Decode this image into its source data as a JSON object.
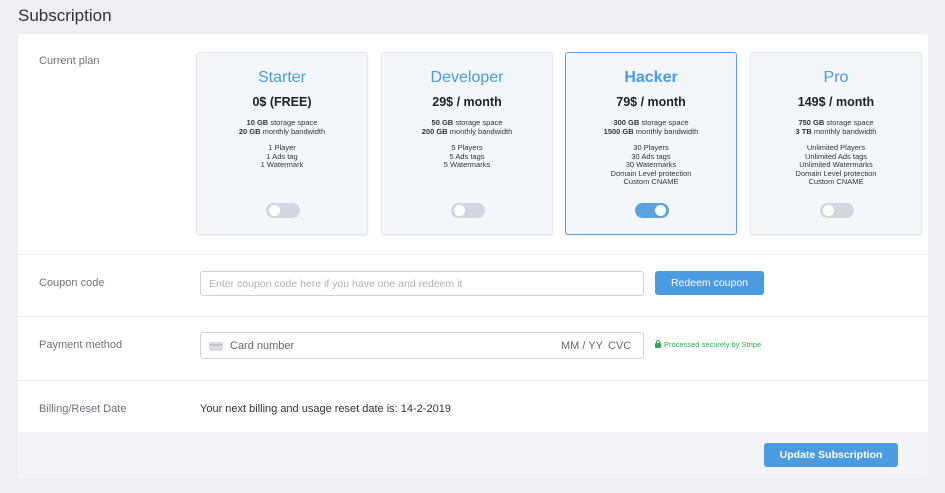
{
  "page": {
    "title": "Subscription"
  },
  "current_plan": {
    "label": "Current plan",
    "plans": [
      {
        "name": "Starter",
        "price": "0$ (FREE)",
        "storage_amount": "10 GB",
        "storage_label": "storage space",
        "bandwidth_amount": "20 GB",
        "bandwidth_label": "monthly bandwidth",
        "features": [
          "1 Player",
          "1 Ads tag",
          "1 Watermark"
        ],
        "selected": false
      },
      {
        "name": "Developer",
        "price": "29$ / month",
        "storage_amount": "50 GB",
        "storage_label": "storage space",
        "bandwidth_amount": "200 GB",
        "bandwidth_label": "monthly bandwidth",
        "features": [
          "5 Players",
          "5 Ads tags",
          "5 Watermarks"
        ],
        "selected": false
      },
      {
        "name": "Hacker",
        "price": "79$ / month",
        "storage_amount": "300 GB",
        "storage_label": "storage space",
        "bandwidth_amount": "1500 GB",
        "bandwidth_label": "monthly bandwidth",
        "features": [
          "30 Players",
          "30 Ads tags",
          "30 Watermarks",
          "Domain Level protection",
          "Custom CNAME"
        ],
        "selected": true
      },
      {
        "name": "Pro",
        "price": "149$ / month",
        "storage_amount": "750 GB",
        "storage_label": "storage space",
        "bandwidth_amount": "3 TB",
        "bandwidth_label": "monthly bandwidth",
        "features": [
          "Unlimited Players",
          "Unlimited Ads tags",
          "Unlimited Watermarks",
          "Domain Level protection",
          "Custom CNAME"
        ],
        "selected": false
      }
    ]
  },
  "coupon": {
    "label": "Coupon code",
    "placeholder": "Enter coupon code here if you have one and redeem it",
    "value": "",
    "button_label": "Redeem coupon"
  },
  "payment": {
    "label": "Payment method",
    "card_number_placeholder": "Card number",
    "expiry_placeholder": "MM / YY",
    "cvc_placeholder": "CVC",
    "secure_note": "Processed securely by Stripe",
    "secure_color": "#2fa84f"
  },
  "billing": {
    "label": "Billing/Reset Date",
    "text": "Your next billing and usage reset date is: 14-2-2019"
  },
  "footer": {
    "update_label": "Update Subscription"
  },
  "colors": {
    "accent": "#4a9be0",
    "toggle_off": "#d3d7dd"
  }
}
